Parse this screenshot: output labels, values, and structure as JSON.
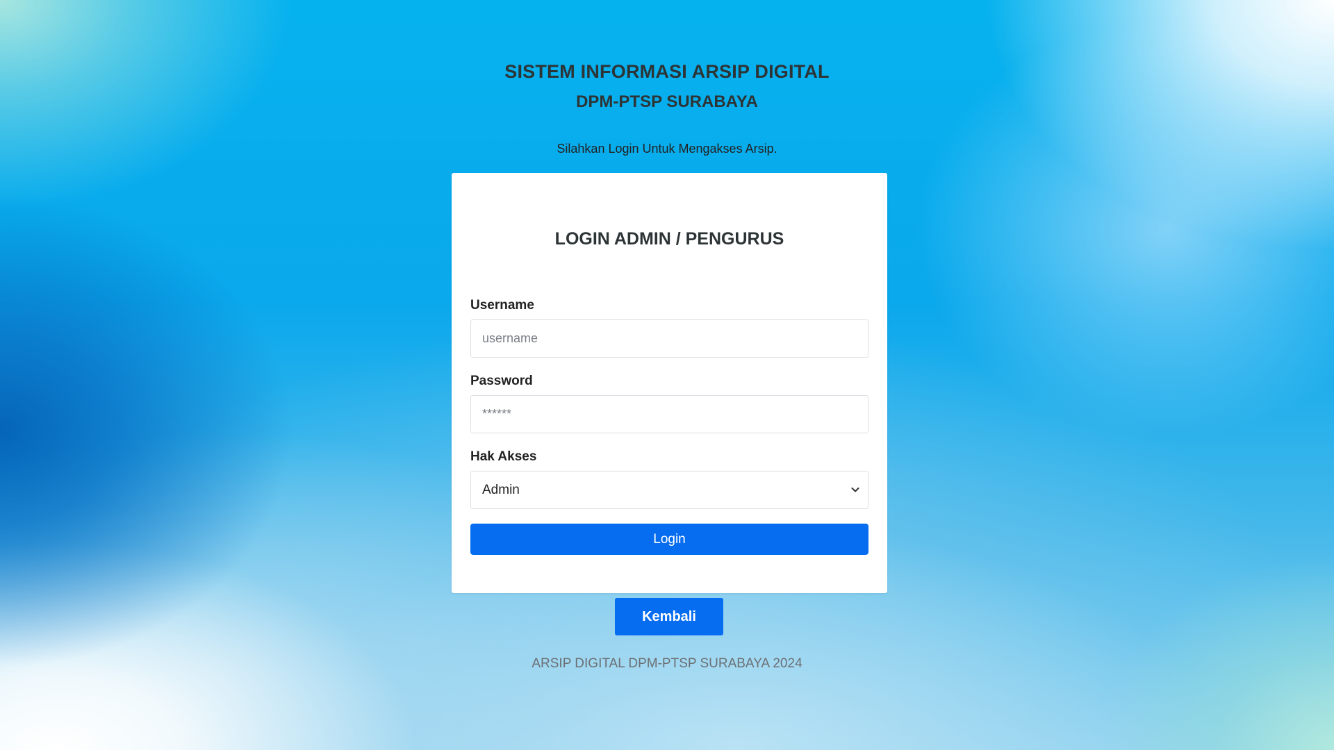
{
  "header": {
    "title": "SISTEM INFORMASI ARSIP DIGITAL",
    "subtitle": "DPM-PTSP SURABAYA",
    "instruction": "Silahkan Login Untuk Mengakses Arsip."
  },
  "login_card": {
    "title": "LOGIN ADMIN / PENGURUS",
    "username": {
      "label": "Username",
      "value": "",
      "placeholder": "username"
    },
    "password": {
      "label": "Password",
      "value": "",
      "placeholder": "******"
    },
    "access": {
      "label": "Hak Akses",
      "selected": "Admin"
    },
    "login_button": "Login"
  },
  "back_button": "Kembali",
  "footer": "ARSIP DIGITAL DPM-PTSP SURABAYA 2024",
  "colors": {
    "primary_button": "#066df0",
    "background_blue": "#08aaec",
    "card": "#ffffff"
  },
  "icons": {
    "select_arrow": "chevron-down-icon"
  }
}
